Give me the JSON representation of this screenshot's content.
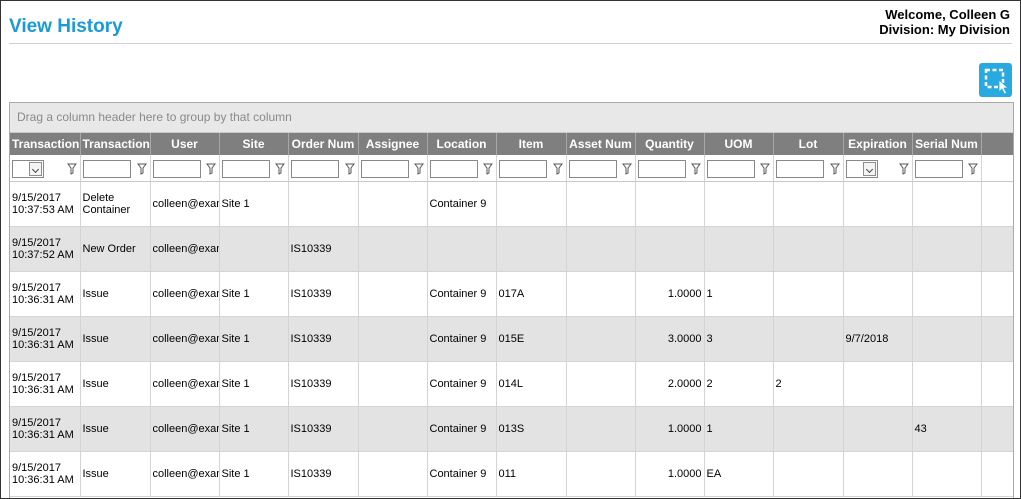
{
  "page": {
    "title": "View History",
    "welcome": "Welcome, Colleen G",
    "division": "Division: My Division"
  },
  "grid": {
    "group_hint": "Drag a column header here to group by that column",
    "columns": [
      "Transaction Date",
      "Transaction",
      "User",
      "Site",
      "Order Num",
      "Assignee",
      "Location",
      "Item",
      "Asset Num",
      "Quantity",
      "UOM",
      "Lot",
      "Expiration",
      "Serial Num"
    ],
    "rows": [
      [
        "9/15/2017 10:37:53 AM",
        "Delete Container",
        "colleen@example.com",
        "Site 1",
        "",
        "",
        "Container 9",
        "",
        "",
        "",
        "",
        "",
        "",
        ""
      ],
      [
        "9/15/2017 10:37:52 AM",
        "New Order",
        "colleen@example.com",
        "",
        "IS10339",
        "",
        "",
        "",
        "",
        "",
        "",
        "",
        "",
        ""
      ],
      [
        "9/15/2017 10:36:31 AM",
        "Issue",
        "colleen@example.com",
        "Site 1",
        "IS10339",
        "",
        "Container 9",
        "017A",
        "",
        "1.0000",
        "1",
        "",
        "",
        ""
      ],
      [
        "9/15/2017 10:36:31 AM",
        "Issue",
        "colleen@example.com",
        "Site 1",
        "IS10339",
        "",
        "Container 9",
        "015E",
        "",
        "3.0000",
        "3",
        "",
        "9/7/2018",
        ""
      ],
      [
        "9/15/2017 10:36:31 AM",
        "Issue",
        "colleen@example.com",
        "Site 1",
        "IS10339",
        "",
        "Container 9",
        "014L",
        "",
        "2.0000",
        "2",
        "2",
        "",
        ""
      ],
      [
        "9/15/2017 10:36:31 AM",
        "Issue",
        "colleen@example.com",
        "Site 1",
        "IS10339",
        "",
        "Container 9",
        "013S",
        "",
        "1.0000",
        "1",
        "",
        "",
        "43"
      ],
      [
        "9/15/2017 10:36:31 AM",
        "Issue",
        "colleen@example.com",
        "Site 1",
        "IS10339",
        "",
        "Container 9",
        "011",
        "",
        "1.0000",
        "EA",
        "",
        "",
        ""
      ]
    ]
  },
  "icons": {
    "select": "selection-cursor-icon",
    "filter": "filter-icon",
    "dropdown": "chevron-down-icon"
  },
  "colors": {
    "title": "#1a9ad6",
    "header_bg": "#7f7f7f",
    "alt_row": "#e3e3e3",
    "select_btn": "#29a9e1"
  }
}
